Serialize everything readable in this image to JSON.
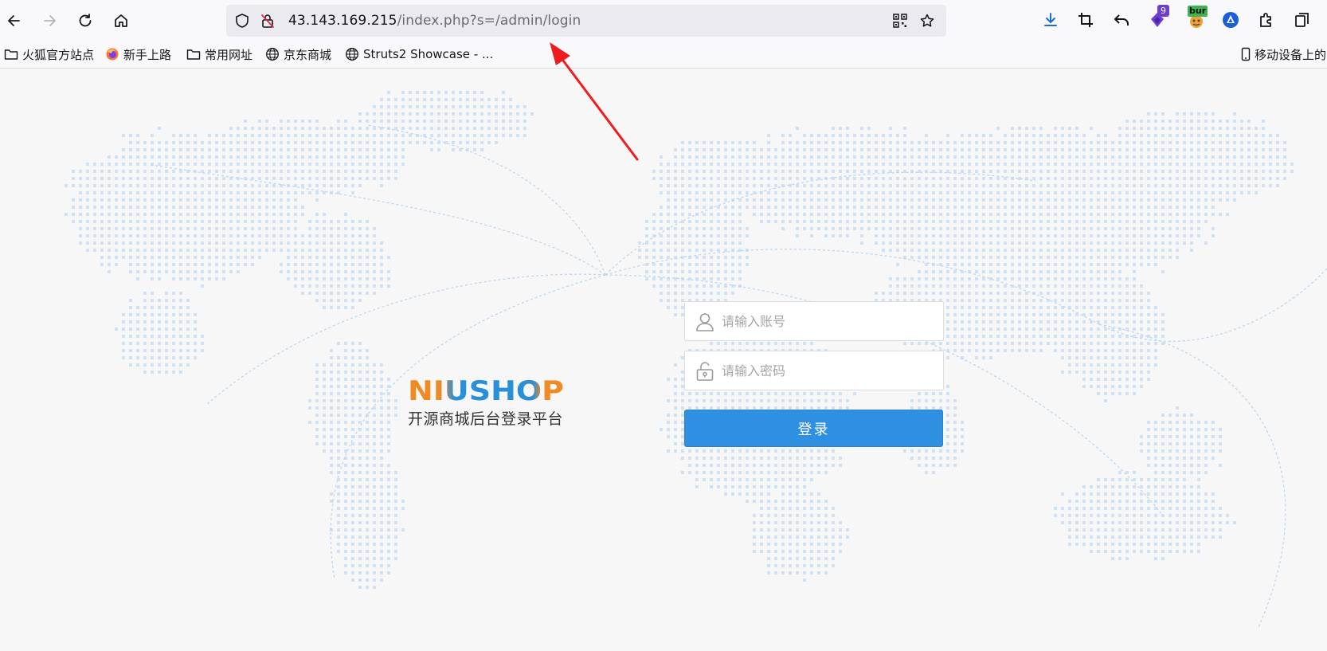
{
  "browser": {
    "url_host": "43.143.169.215",
    "url_path": "/index.php?s=/admin/login",
    "extension_badges": {
      "counter": "9",
      "burp": "bur"
    },
    "icons": {
      "back": "back-arrow-icon",
      "forward": "forward-arrow-icon",
      "reload": "reload-icon",
      "home": "home-icon",
      "shield": "tracking-shield-icon",
      "insecure": "insecure-lock-icon",
      "qr": "qr-code-icon",
      "star": "bookmark-star-icon",
      "download": "download-icon",
      "crop": "screenshot-crop-icon",
      "undo": "undo-icon",
      "extensions": "extensions-puzzle-icon",
      "overflow": "overflow-menu-icon"
    }
  },
  "bookmarks": {
    "items": [
      {
        "label": "火狐官方站点",
        "icon": "folder-icon"
      },
      {
        "label": "新手上路",
        "icon": "firefox-icon"
      },
      {
        "label": "常用网址",
        "icon": "folder-icon"
      },
      {
        "label": "京东商城",
        "icon": "globe-icon"
      },
      {
        "label": "Struts2 Showcase - ...",
        "icon": "globe-icon"
      }
    ],
    "mobile_label": "移动设备上的"
  },
  "login": {
    "logo_text": "NIUSHOP",
    "subtitle": "开源商城后台登录平台",
    "username_placeholder": "请输入账号",
    "password_placeholder": "请输入密码",
    "submit_label": "登录"
  },
  "colors": {
    "accent_blue": "#2f8fe0",
    "logo_orange": "#f08a24",
    "logo_blue": "#2a8fd9",
    "annotation_arrow": "#ee1c1c"
  }
}
